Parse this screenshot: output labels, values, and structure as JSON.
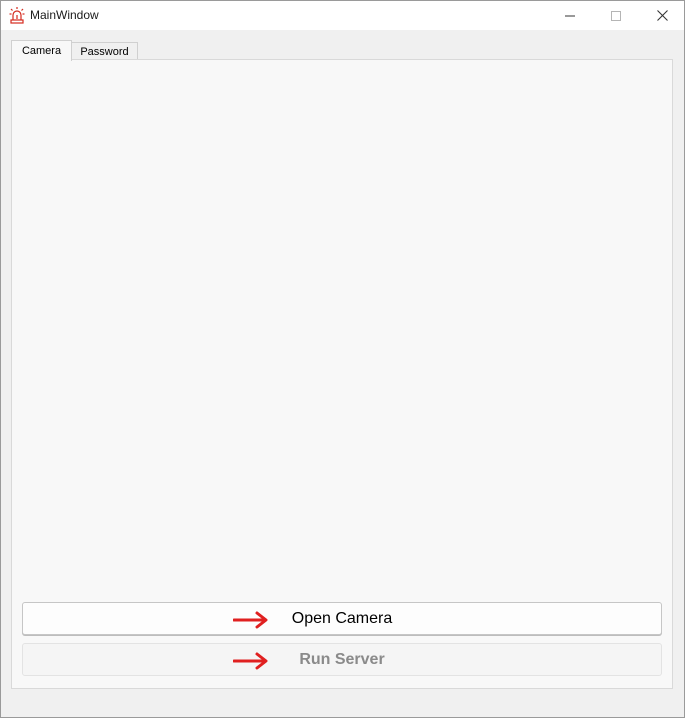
{
  "window": {
    "title": "MainWindow",
    "icon": "alarm-light-icon",
    "controls": [
      "minimize-icon",
      "maximize-icon",
      "close-icon"
    ]
  },
  "tabs": [
    {
      "label": "Camera",
      "active": true
    },
    {
      "label": "Password",
      "active": false
    }
  ],
  "buttons": {
    "open_camera": {
      "label": "Open Camera",
      "enabled": true,
      "annotation": "red-arrow-icon"
    },
    "run_server": {
      "label": "Run Server",
      "enabled": false,
      "annotation": "red-arrow-icon"
    }
  },
  "colors": {
    "annotation_red": "#e02020",
    "icon_red": "#d42a1e"
  }
}
